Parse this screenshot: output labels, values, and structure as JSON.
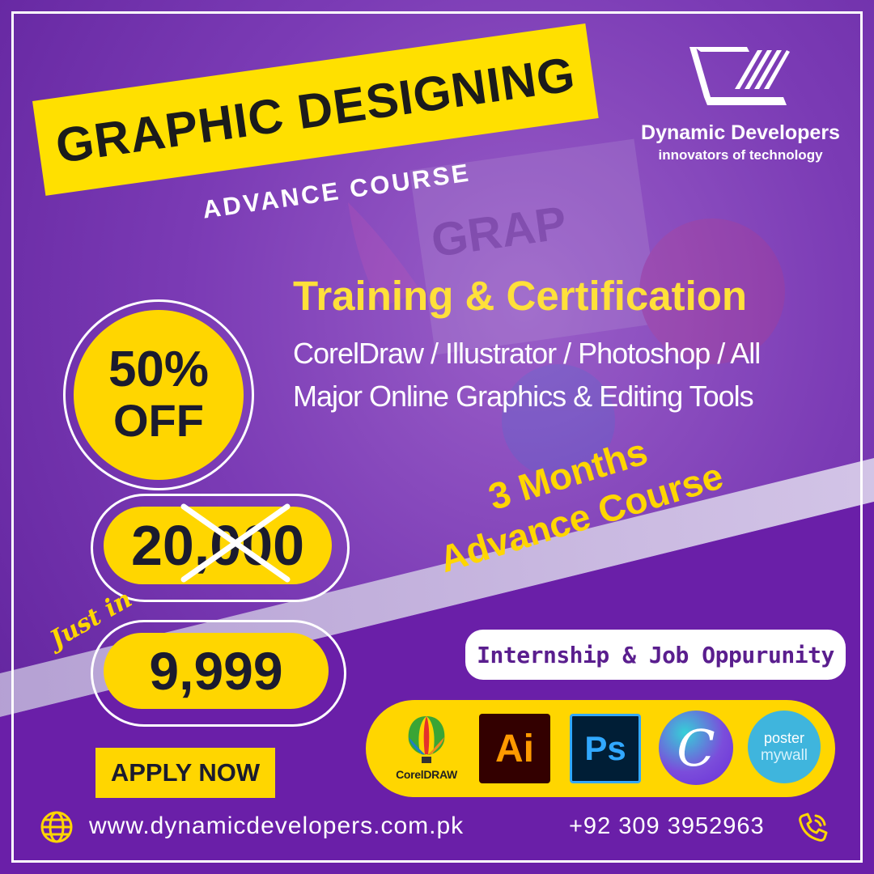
{
  "brand": {
    "name": "Dynamic Developers",
    "tagline": "innovators of technology"
  },
  "banner": {
    "title": "GRAPHIC DESIGNING",
    "subtitle": "ADVANCE COURSE"
  },
  "offer": {
    "percent": "50%",
    "off_label": "OFF",
    "old_price": "20,000",
    "just_in_label": "Just in",
    "new_price": "9,999"
  },
  "course": {
    "heading": "Training & Certification",
    "tools_text": "CorelDraw / Illustrator / Photoshop / All Major Online Graphics & Editing Tools",
    "duration_line1": "3 Months",
    "duration_line2": "Advance Course"
  },
  "internship_label": "Internship & Job Oppurunity",
  "apply_label": "APPLY NOW",
  "tools": {
    "coreldraw_label": "CorelDRAW",
    "illustrator_label": "Ai",
    "photoshop_label": "Ps",
    "canva_label": "C",
    "postermywall_line1": "poster",
    "postermywall_line2": "mywall"
  },
  "contact": {
    "website": "www.dynamicdevelopers.com.pk",
    "phone": "+92 309 3952963",
    "globe_icon": "globe-icon",
    "phone_icon": "phone-icon"
  },
  "colors": {
    "yellow": "#ffd600",
    "purple_dark": "#5d1f99",
    "purple_light": "#9a5fc8",
    "text_dark": "#1b1b2e"
  }
}
